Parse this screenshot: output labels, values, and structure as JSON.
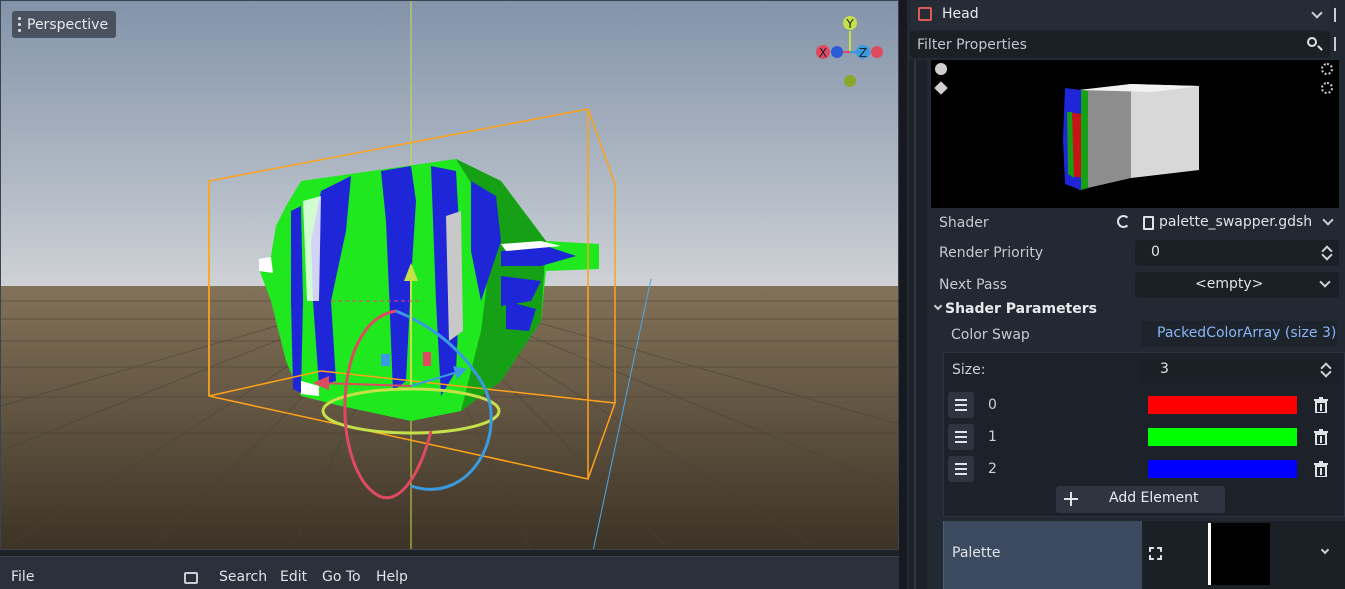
{
  "viewport": {
    "view_label": "Perspective",
    "gizmo": {
      "y": "Y",
      "x": "X",
      "z": "Z"
    }
  },
  "bottom_bar": {
    "file": "File",
    "search": "Search",
    "edit": "Edit",
    "go_to": "Go To",
    "help": "Help"
  },
  "inspector": {
    "node_name": "Head",
    "filter_placeholder": "Filter Properties",
    "shader": {
      "label": "Shader",
      "value": "palette_swapper.gdsh"
    },
    "render_priority": {
      "label": "Render Priority",
      "value": "0"
    },
    "next_pass": {
      "label": "Next Pass",
      "value": "<empty>"
    },
    "shader_parameters": {
      "title": "Shader Parameters",
      "color_swap": {
        "label": "Color Swap",
        "value": "PackedColorArray (size 3)",
        "size_label": "Size:",
        "size_value": "3",
        "elements": [
          {
            "index": "0",
            "color": "#ff0000"
          },
          {
            "index": "1",
            "color": "#00ff00"
          },
          {
            "index": "2",
            "color": "#0000ff"
          }
        ],
        "add_element_label": "Add Element"
      },
      "palette": {
        "label": "Palette"
      }
    }
  },
  "colors": {
    "accent": "#8ab4f8",
    "box_outline": "#ffa500",
    "selection_blue": "#3b4a5f"
  }
}
